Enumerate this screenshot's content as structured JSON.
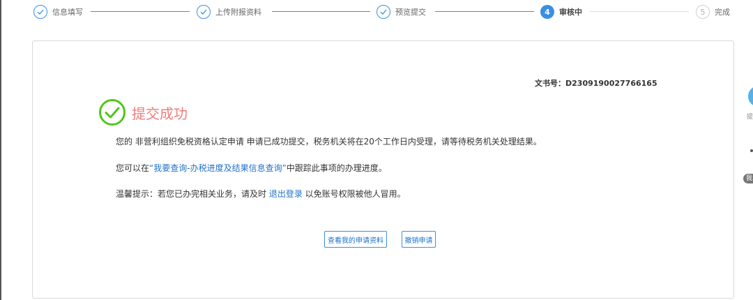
{
  "steps": [
    {
      "label": "信息填写",
      "state": "done"
    },
    {
      "label": "上传附报资料",
      "state": "done"
    },
    {
      "label": "预览提交",
      "state": "done"
    },
    {
      "label": "审核中",
      "state": "active",
      "number": "4"
    },
    {
      "label": "完成",
      "state": "todo",
      "number": "5"
    }
  ],
  "doc": {
    "label": "文书号：",
    "number": "D2309190027766165"
  },
  "result": {
    "title": "提交成功",
    "color_success_icon": "#52c41a",
    "color_title": "#f07c7c"
  },
  "messages": {
    "line1": "您的 非营利组织免税资格认定申请 申请已成功提交，税务机关将在20个工作日内受理，请等待税务机关处理结果。",
    "line2_prefix": "您可以在",
    "line2_link": "“我要查询-办税进度及结果信息查询”",
    "line2_suffix": "中跟踪此事项的办理进度。",
    "line3_prefix": "温馨提示：若您已办完相关业务，请及时 ",
    "line3_link": "退出登录",
    "line3_suffix": " 以免账号权限被他人冒用。"
  },
  "buttons": {
    "view_label": "查看我的申请资料",
    "revoke_label": "撤销申请"
  },
  "side": {
    "text": "提",
    "pill_text": "我"
  },
  "colors": {
    "accent": "#3a8ee6",
    "link": "#1f72c9"
  }
}
